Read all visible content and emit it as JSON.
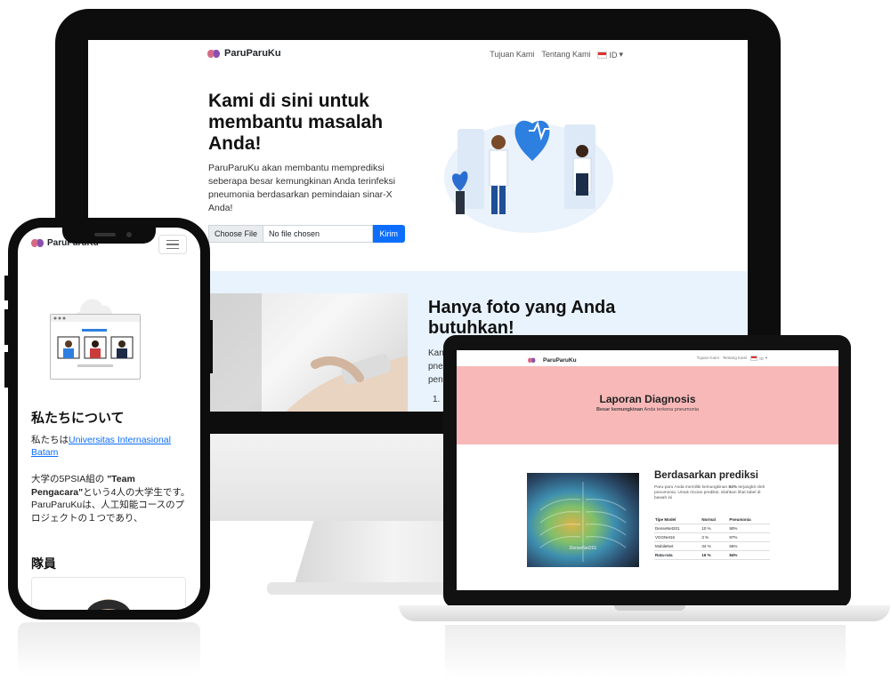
{
  "desktop": {
    "brand": "ParuParuKu",
    "nav": {
      "item1": "Tujuan Kami",
      "item2": "Tentang Kami",
      "lang": "ID",
      "lang_caret": "▾"
    },
    "hero": {
      "title": "Kami di sini untuk membantu masalah Anda!",
      "description": "ParuParuKu akan membantu memprediksi seberapa besar kemungkinan Anda terinfeksi pneumonia berdasarkan pemindaian sinar-X Anda!",
      "choose_file": "Choose File",
      "file_name": "No file chosen",
      "submit": "Kirim"
    },
    "section2": {
      "title": "Hanya foto yang Anda butuhkan!",
      "text": "Kan pne pen",
      "list_item": "1."
    }
  },
  "laptop": {
    "brand": "ParuParuKu",
    "nav": {
      "item1": "Tujuan Kami",
      "item2": "Tentang Kami",
      "lang": "ID",
      "lang_caret": "▾"
    },
    "banner": {
      "title": "Laporan Diagnosis",
      "subtitle_bold": "Besar kemungkinan",
      "subtitle_rest": " Anda terkena pneumonia"
    },
    "xray_label": "DenseNet201",
    "result": {
      "title": "Berdasarkan prediksi",
      "text_pre": "Paru-paru Anda memiliki kemungkinan ",
      "text_pct": "84%",
      "text_post": " terjangkit oleh pneumonia. Untuk rincian prediksi, silahkan lihat tabel di bawah ini"
    },
    "table": {
      "headers": [
        "Tipe Model",
        "Normal",
        "Pneumonia"
      ],
      "rows": [
        [
          "DenseNet201",
          "10 %",
          "90%"
        ],
        [
          "VGGNet16",
          "3 %",
          "97%"
        ],
        [
          "MobileNet",
          "34 %",
          "66%"
        ],
        [
          "Rata-rata",
          "16 %",
          "84%"
        ]
      ]
    }
  },
  "phone": {
    "brand": "ParuParuKu",
    "about_title": "私たちについて",
    "about_text_pre": "私たちは",
    "about_link": "Universitas Internasional Batam",
    "about_text2_pre": "大学の5PSIA組の ",
    "about_text2_bold": "\"Team Pengacara\"",
    "about_text2_post": "という4人の大学生です。ParuParuKuは、人工知能コースのプロジェクトの１つであり、",
    "members_title": "隊員"
  },
  "colors": {
    "primary": "#0d6efd",
    "banner_pink": "#f8b8b8",
    "section_blue": "#e8f3fd",
    "device_black": "#0d0d0d"
  }
}
